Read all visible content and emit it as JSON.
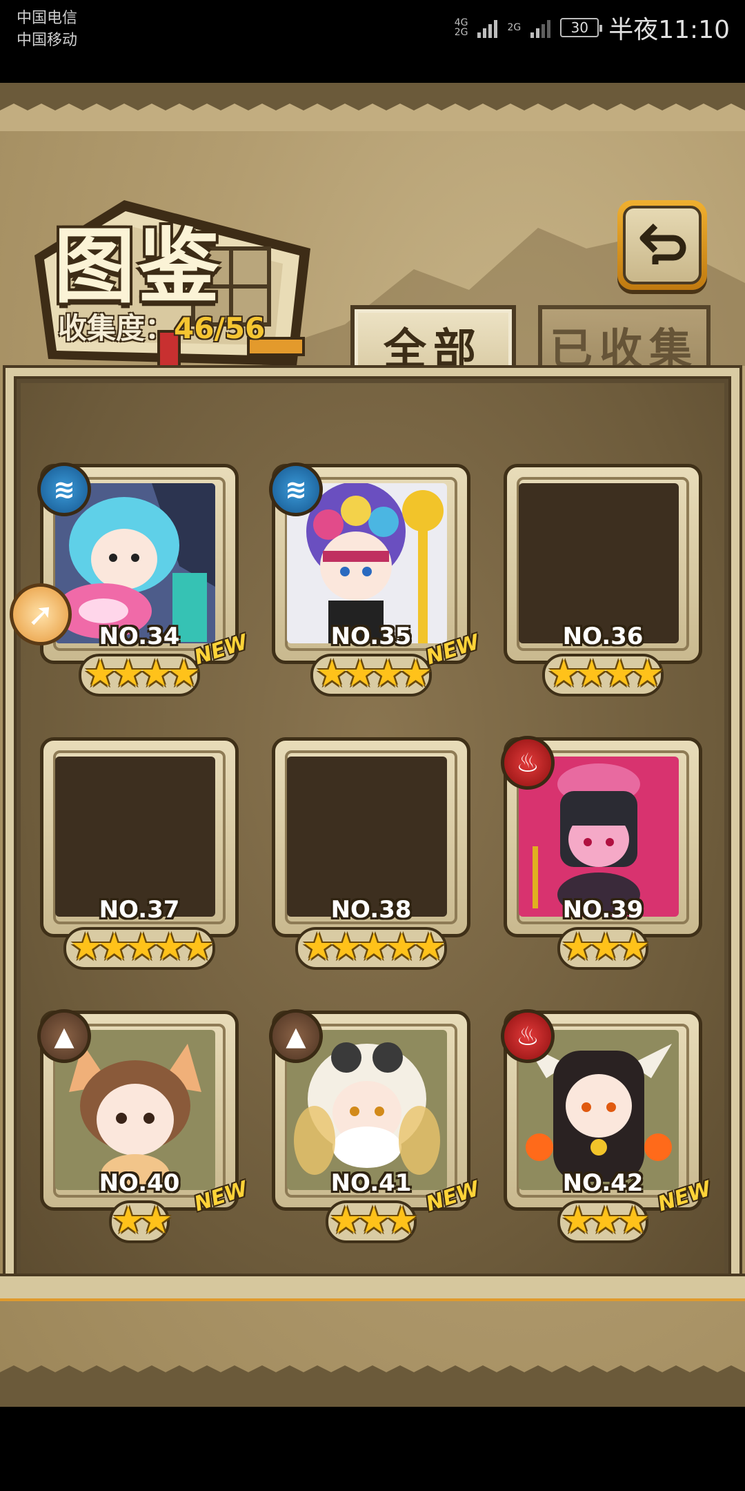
{
  "status_bar": {
    "carrier1": "中国电信",
    "carrier2": "中国移动",
    "net1": "4G",
    "net2": "2G",
    "net3": "2G",
    "battery": "30",
    "time": "半夜11:10"
  },
  "header": {
    "title": "图鉴",
    "collection_label": "收集度：",
    "collection_value": "46/56"
  },
  "tabs": [
    {
      "label": "全部",
      "active": true
    },
    {
      "label": "已收集",
      "active": false
    }
  ],
  "cards": [
    {
      "no": "NO.34",
      "stars": "★★★★",
      "new": "NEW",
      "element": "water",
      "element_icon": "water-waves-icon",
      "collected": true
    },
    {
      "no": "NO.35",
      "stars": "★★★★",
      "new": "NEW",
      "element": "water",
      "element_icon": "water-waves-icon",
      "collected": true
    },
    {
      "no": "NO.36",
      "stars": "★★★★",
      "new": "",
      "element": "",
      "collected": false
    },
    {
      "no": "NO.37",
      "stars": "★★★★★",
      "new": "",
      "element": "",
      "collected": false
    },
    {
      "no": "NO.38",
      "stars": "★★★★★",
      "new": "",
      "element": "",
      "collected": false
    },
    {
      "no": "NO.39",
      "stars": "★★★",
      "new": "",
      "element": "fire",
      "element_icon": "flame-icon",
      "collected": true
    },
    {
      "no": "NO.40",
      "stars": "★★",
      "new": "NEW",
      "element": "earth",
      "element_icon": "mountain-icon",
      "collected": true
    },
    {
      "no": "NO.41",
      "stars": "★★★",
      "new": "NEW",
      "element": "earth",
      "element_icon": "mountain-icon",
      "collected": true
    },
    {
      "no": "NO.42",
      "stars": "★★★",
      "new": "NEW",
      "element": "fire",
      "element_icon": "flame-icon",
      "collected": true
    }
  ],
  "colors": {
    "accent_gold": "#f5c531",
    "frame_dark": "#3f3018",
    "parchment": "#b39d70",
    "water": "#1f6fb0",
    "fire": "#b81c1c",
    "earth": "#6b4a33"
  }
}
